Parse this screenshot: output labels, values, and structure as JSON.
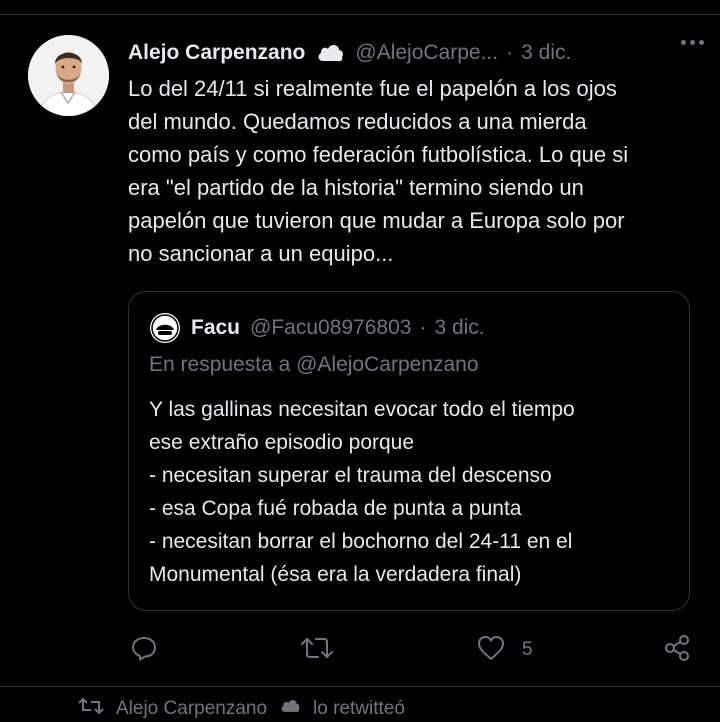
{
  "tweet": {
    "author_name": "Alejo Carpenzano",
    "handle": "@AlejoCarpe...",
    "separator": "·",
    "date": "3 dic.",
    "text": "Lo del 24/11 si realmente fue el papelón a los ojos\ndel mundo. Quedamos reducidos a una mierda\ncomo país y como federación futbolística. Lo que si\nera \"el partido de la historia\" termino siendo un\npapelón que tuvieron que mudar a Europa solo por\nno sancionar a un equipo..."
  },
  "quoted_tweet": {
    "author_name": "Facu",
    "handle": "@Facu08976803",
    "separator": "·",
    "date": "3 dic.",
    "reply_to": "En respuesta a @AlejoCarpenzano",
    "text": "Y las gallinas necesitan evocar todo el tiempo\nese extraño episodio porque\n- necesitan superar el trauma del descenso\n- esa Copa fué robada de punta a punta\n- necesitan borrar el bochorno del 24-11 en el\nMonumental (ésa era la verdadera final)"
  },
  "actions": {
    "like_count": "5"
  },
  "next_row": {
    "name": "Alejo Carpenzano",
    "text": "lo retwitteó"
  },
  "icons": {
    "badge": "cloud-icon",
    "more": "more-options-icon",
    "reply": "reply-icon",
    "retweet": "retweet-icon",
    "like": "heart-icon",
    "share": "share-icon"
  },
  "colors": {
    "background": "#000000",
    "text": "#e7e9ea",
    "muted": "#71767b",
    "border": "#2f3336"
  }
}
